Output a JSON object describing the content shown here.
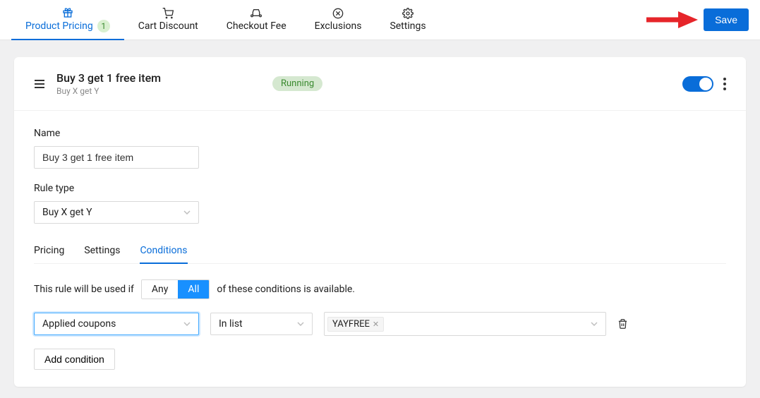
{
  "nav": {
    "tabs": [
      {
        "label": "Product Pricing",
        "badge": "1",
        "active": true
      },
      {
        "label": "Cart Discount"
      },
      {
        "label": "Checkout Fee"
      },
      {
        "label": "Exclusions"
      },
      {
        "label": "Settings"
      }
    ],
    "save_label": "Save"
  },
  "rule": {
    "title": "Buy 3 get 1 free item",
    "subtitle": "Buy X get Y",
    "status": "Running"
  },
  "form": {
    "name_label": "Name",
    "name_value": "Buy 3 get 1 free item",
    "ruletype_label": "Rule type",
    "ruletype_value": "Buy X get Y"
  },
  "inner_tabs": [
    {
      "label": "Pricing"
    },
    {
      "label": "Settings"
    },
    {
      "label": "Conditions",
      "active": true
    }
  ],
  "conditions": {
    "prefix": "This rule will be used if",
    "any": "Any",
    "all": "All",
    "suffix": "of these conditions is available.",
    "field_value": "Applied coupons",
    "op_value": "In list",
    "tag_value": "YAYFREE",
    "add_label": "Add condition"
  }
}
